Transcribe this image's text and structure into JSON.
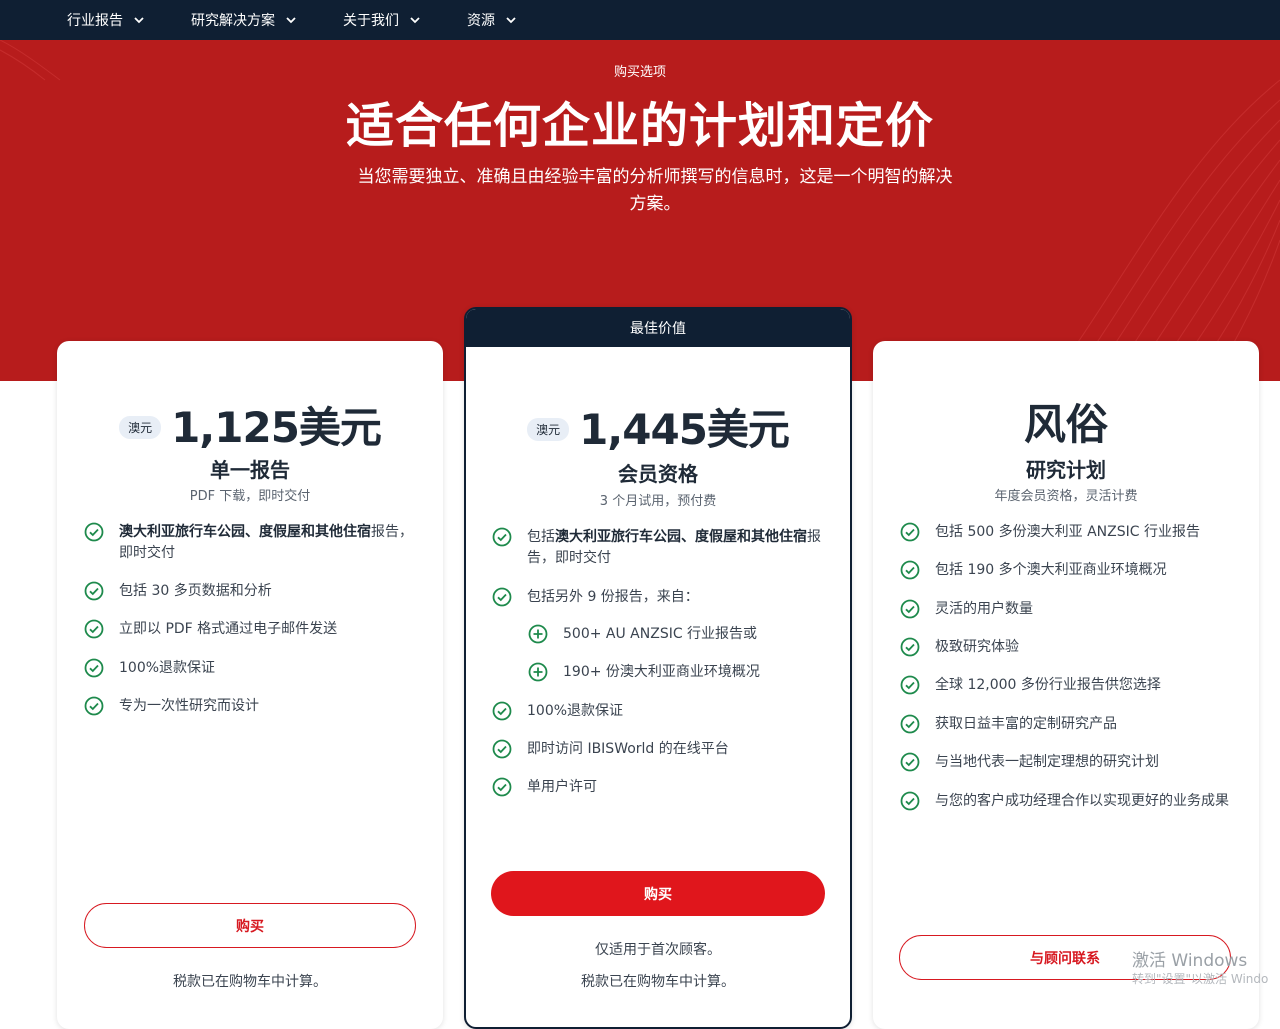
{
  "nav": {
    "items": [
      {
        "label": "行业报告"
      },
      {
        "label": "研究解决方案"
      },
      {
        "label": "关于我们"
      },
      {
        "label": "资源"
      }
    ]
  },
  "hero": {
    "eyebrow": "购买选项",
    "title": "适合任何企业的计划和定价",
    "subtitle_line1": "当您需要独立、准确且由经验丰富的分析师撰写的信息时，这是一个明智的解决",
    "subtitle_line2": "方案。"
  },
  "colors": {
    "nav_bg": "#0f1f33",
    "hero_bg": "#b71c1c",
    "accent": "#e0161c",
    "check": "#1e8a4c"
  },
  "plans": {
    "single": {
      "currency": "澳元",
      "price": "1,125美元",
      "name": "单一报告",
      "note": "PDF 下载，即时交付",
      "features": [
        {
          "bold": "澳大利亚旅行车公园、度假屋和其他住宿",
          "text": "报告，",
          "line2": "即时交付"
        },
        {
          "text": "包括 30 多页数据和分析"
        },
        {
          "text": "立即以 PDF 格式通过电子邮件发送"
        },
        {
          "text": "100%退款保证"
        },
        {
          "text": "专为一次性研究而设计"
        }
      ],
      "button": "购买",
      "footnote": "税款已在购物车中计算。"
    },
    "membership": {
      "ribbon": "最佳价值",
      "currency": "澳元",
      "price": "1,445美元",
      "name": "会员资格",
      "note": "3 个月试用，预付费",
      "features": [
        {
          "prefix": "包括",
          "bold": "澳大利亚旅行车公园、度假屋和其他住宿",
          "text": "报",
          "line2": "告，即时交付"
        },
        {
          "text": "包括另外 9 份报告，来自："
        },
        {
          "text": "500+ AU ANZSIC 行业报告或",
          "plus": true
        },
        {
          "text": "190+ 份澳大利亚商业环境概况",
          "plus": true
        },
        {
          "text": "100%退款保证"
        },
        {
          "text": "即时访问 IBISWorld 的在线平台"
        },
        {
          "text": "单用户许可"
        }
      ],
      "button": "购买",
      "footnote1": "仅适用于首次顾客。",
      "footnote2": "税款已在购物车中计算。"
    },
    "custom": {
      "title": "风俗",
      "name": "研究计划",
      "note": "年度会员资格，灵活计费",
      "features": [
        {
          "text": "包括 500 多份澳大利亚 ANZSIC 行业报告"
        },
        {
          "text": "包括 190 多个澳大利亚商业环境概况"
        },
        {
          "text": "灵活的用户数量"
        },
        {
          "text": "极致研究体验"
        },
        {
          "text": "全球 12,000 多份行业报告供您选择"
        },
        {
          "text": "获取日益丰富的定制研究产品"
        },
        {
          "text": "与当地代表一起制定理想的研究计划"
        },
        {
          "text": "与您的客户成功经理合作以实现更好的业务成果"
        }
      ],
      "button": "与顾问联系"
    }
  },
  "watermark": {
    "line1": "激活 Windows",
    "line2": "转到\"设置\"以激活 Windo"
  }
}
